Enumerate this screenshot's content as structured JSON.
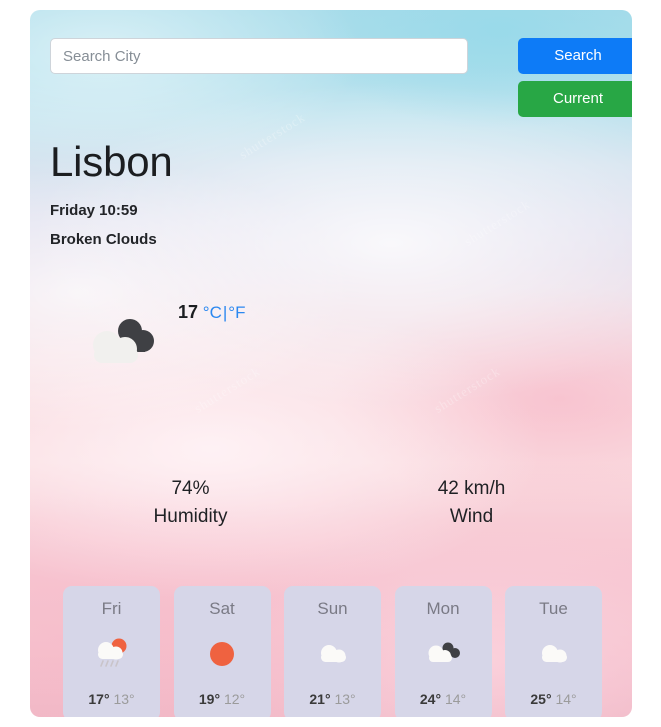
{
  "search": {
    "placeholder": "Search City",
    "value": "",
    "search_label": "Search",
    "current_label": "Current"
  },
  "colors": {
    "search_button": "#0d7bf7",
    "current_button": "#28a745",
    "unit_link": "#2b88f0",
    "forecast_card": "#d6d6e8",
    "sun": "#ef6240",
    "cloud_light": "#f1f0ee",
    "cloud_dark": "#3f4044"
  },
  "current": {
    "city": "Lisbon",
    "datetime": "Friday 10:59",
    "condition": "Broken Clouds",
    "temperature": "17",
    "unit_celsius": "°C",
    "unit_separator": "|",
    "unit_fahrenheit": "°F",
    "icon": "broken-clouds-icon",
    "humidity_value": "74%",
    "humidity_label": "Humidity",
    "wind_value": "42 km/h",
    "wind_label": "Wind"
  },
  "forecast": [
    {
      "day": "Fri",
      "icon": "sun-rain-cloud-icon",
      "high": "17°",
      "low": "13°"
    },
    {
      "day": "Sat",
      "icon": "sun-icon",
      "high": "19°",
      "low": "12°"
    },
    {
      "day": "Sun",
      "icon": "cloud-icon",
      "high": "21°",
      "low": "13°"
    },
    {
      "day": "Mon",
      "icon": "broken-clouds-icon",
      "high": "24°",
      "low": "14°"
    },
    {
      "day": "Tue",
      "icon": "cloud-icon",
      "high": "25°",
      "low": "14°"
    }
  ],
  "watermarks": [
    "shutterstock",
    "shutterstock",
    "shutterstock",
    "shutterstock"
  ]
}
